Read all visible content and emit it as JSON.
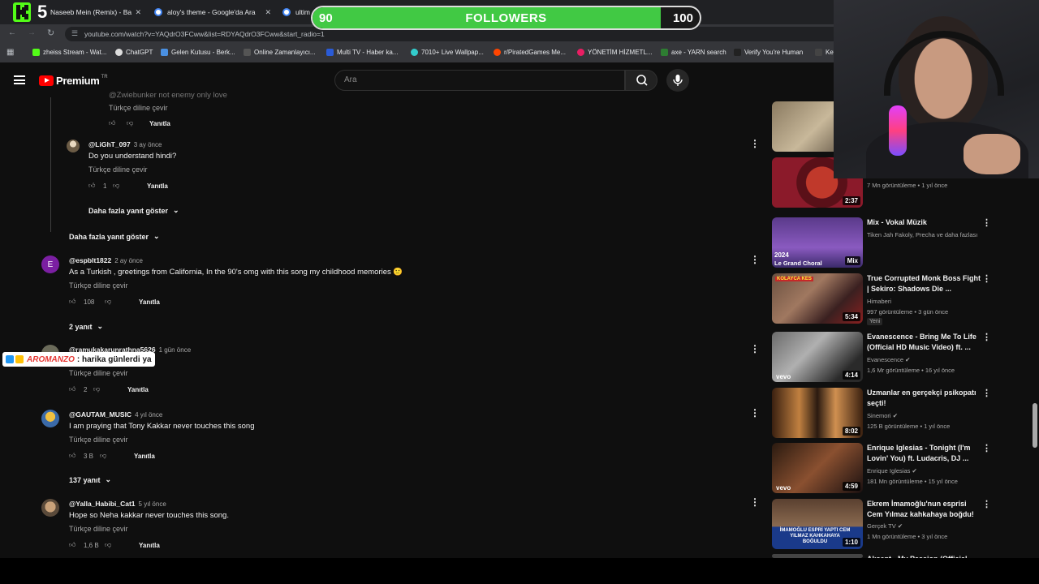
{
  "browser": {
    "tabs": [
      {
        "label": "Naseeb Mein (Remix) - Ba"
      },
      {
        "label": "aloy's theme - Google'da Ara"
      },
      {
        "label": "ultim"
      }
    ],
    "url": "youtube.com/watch?v=YAQdrO3FCww&list=RDYAQdrO3FCww&start_radio=1",
    "bookmarks": [
      "zheiss Stream - Wat...",
      "ChatGPT",
      "Gelen Kutusu - Berk...",
      "Online Zamanlayıcı...",
      "Multi TV - Haber ka...",
      "7010+ Live Wallpap...",
      "r/PiratedGames Me...",
      "YÖNETİM HİZMETL...",
      "axe - YARN search",
      "Verify You're Human",
      "Key"
    ]
  },
  "overlay": {
    "counter": "5",
    "followers_label": "FOLLOWERS",
    "followers_current": "90",
    "followers_goal": "100",
    "followers_progress": 0.9,
    "chat_user": "AROMANZO",
    "chat_text": ": harika günlerdi ya"
  },
  "header": {
    "logo": "Premium",
    "region": "TR",
    "search_placeholder": "Ara"
  },
  "comments": {
    "translate": "Türkçe diline çevir",
    "reply": "Yanıtla",
    "top_partial": {
      "text": "@Zwiebunker not enemy only love"
    },
    "c1": {
      "author": "@LiGhT_097",
      "when": "3 ay önce",
      "text": "Do you understand hindi?",
      "likes": "1"
    },
    "more_replies_inner": "Daha fazla yanıt göster",
    "more_replies_outer": "Daha fazla yanıt göster",
    "c2": {
      "author": "@espblt1822",
      "when": "2 ay önce",
      "text": "As a Turkish , greetings from California, In the 90's omg with this song my childhood memories 🙂",
      "likes": "108",
      "avatar_letter": "E"
    },
    "c2_replies": "2 yanıt",
    "c3": {
      "author": "@ramukakarunrathna5626",
      "when": "1 gün önce",
      "likes": "2"
    },
    "c4": {
      "author": "@GAUTAM_MUSIC",
      "when": "4 yıl önce",
      "text": "I am praying that Tony Kakkar never touches this song",
      "likes": "3 B"
    },
    "c4_replies": "137 yanıt",
    "c5": {
      "author": "@Yalla_Habibi_Cat1",
      "when": "5 yıl önce",
      "text": "Hope so Neha kakkar never touches this song.",
      "likes": "1,6 B"
    }
  },
  "sidebar": {
    "v0": {
      "duration": ""
    },
    "v1": {
      "meta": "7 Mn görüntüleme • 1 yıl önce",
      "duration": "2:37"
    },
    "v2": {
      "title": "Mix - Vokal Müzik",
      "meta": "Tiken Jah Fakoly, Precha ve daha fazlası",
      "badge": "Mix",
      "thumb_text1": "2024",
      "thumb_text2": "Le Grand Choral"
    },
    "v3": {
      "title": "True Corrupted Monk Boss Fight | Sekiro: Shadows Die ...",
      "channel": "Himaberi",
      "meta": "997 görüntüleme • 3 gün önce",
      "badge": "Yeni",
      "duration": "5:34",
      "thumb_text": "KOLAYCA KES"
    },
    "v4": {
      "title": "Evanescence - Bring Me To Life (Official HD Music Video) ft. ...",
      "channel": "Evanescence",
      "meta": "1,6 Mr görüntüleme • 16 yıl önce",
      "duration": "4:14",
      "brand": "vevo"
    },
    "v5": {
      "title": "Uzmanlar en gerçekçi psikopatı seçti!",
      "channel": "Sinemori",
      "meta": "125 B görüntüleme • 1 yıl önce",
      "duration": "8:02"
    },
    "v6": {
      "title": "Enrique Iglesias - Tonight (I'm Lovin' You) ft. Ludacris, DJ ...",
      "channel": "Enrique Iglesias",
      "meta": "181 Mn görüntüleme • 15 yıl önce",
      "duration": "4:59",
      "brand": "vevo"
    },
    "v7": {
      "title": "Ekrem İmamoğlu'nun esprisi Cem Yılmaz kahkahaya boğdu!",
      "channel": "Gerçek TV",
      "meta": "1 Mn görüntüleme • 3 yıl önce",
      "duration": "1:10",
      "thumb_text": "İMAMOĞLU ESPRİ YAPTI CEM YILMAZ KAHKAHAYA BOĞULDU"
    },
    "v8": {
      "title": "Aksent - My Passion (Official"
    }
  },
  "colors": {
    "accent": "#ff0000",
    "progress_fill": "#41c944",
    "background": "#0f0f0f"
  }
}
